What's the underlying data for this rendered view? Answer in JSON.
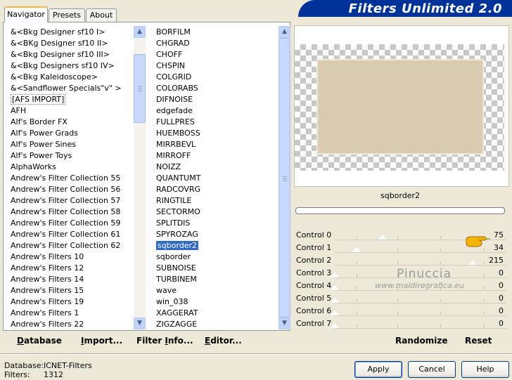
{
  "tabs": [
    "Navigator",
    "Presets",
    "About"
  ],
  "app_title": "Filters Unlimited 2.0",
  "categories": [
    "&<Bkg Designer sf10 I>",
    "&<BKg Designer sf10 II>",
    "&<Bkg Designer sf10 III>",
    "&<Bkg Designers sf10 IV>",
    "&<Bkg Kaleidoscope>",
    "&<Sandflower Specials\"v\" >",
    "[AFS IMPORT]",
    "AFH",
    "Alf's Border FX",
    "Alf's Power Grads",
    "Alf's Power Sines",
    "Alf's Power Toys",
    "AlphaWorks",
    "Andrew's Filter Collection 55",
    "Andrew's Filter Collection 56",
    "Andrew's Filter Collection 57",
    "Andrew's Filter Collection 58",
    "Andrew's Filter Collection 59",
    "Andrew's Filter Collection 61",
    "Andrew's Filter Collection 62",
    "Andrew's Filters 10",
    "Andrew's Filters 12",
    "Andrew's Filters 14",
    "Andrew's Filters 15",
    "Andrew's Filters 19",
    "Andrew's Filters 1",
    "Andrew's Filters 22"
  ],
  "filters": [
    "BORFILM",
    "CHGRAD",
    "CHOFF",
    "CHSPIN",
    "COLGRID",
    "COLORABS",
    "DIFNOISE",
    "edgefade",
    "FULLPRES",
    "HUEMBOSS",
    "MIRRBEVL",
    "MIRROFF",
    "NOIZZ",
    "QUANTUMT",
    "RADCOVRG",
    "RINGTILE",
    "SECTORMO",
    "SPLITDIS",
    "SPYROZAG",
    "sqborder2",
    "sqborder",
    "SUBNOISE",
    "TURBINEM",
    "wave",
    "win_038",
    "XAGGERAT",
    "ZIGZAGGE"
  ],
  "filter_name": "sqborder2",
  "controls": [
    {
      "label": "Control 0",
      "value": "75"
    },
    {
      "label": "Control 1",
      "value": "34"
    },
    {
      "label": "Control 2",
      "value": "215"
    },
    {
      "label": "Control 3",
      "value": "0"
    },
    {
      "label": "Control 4",
      "value": "0"
    },
    {
      "label": "Control 5",
      "value": "0"
    },
    {
      "label": "Control 6",
      "value": "0"
    },
    {
      "label": "Control 7",
      "value": "0"
    }
  ],
  "watermark": {
    "name": "Pinuccia",
    "url": "www.maidiregrafica.eu"
  },
  "left_buttons": {
    "database": {
      "u": "D",
      "rest": "atabase"
    },
    "import": {
      "u": "I",
      "rest": "mport..."
    },
    "filter_info": {
      "pre": "Filter ",
      "u": "I",
      "rest": "nfo..."
    },
    "editor": {
      "u": "E",
      "rest": "ditor..."
    }
  },
  "randomize": "Randomize",
  "reset": "Reset",
  "status": {
    "database_label": "Database:",
    "database_value": "ICNET-Filters",
    "filters_label": "Filters:",
    "filters_value": "1312"
  },
  "buttons": {
    "apply": "Apply",
    "cancel": "Cancel",
    "help": "Help"
  },
  "colors": {
    "banner": "#003399",
    "selection": "#316ac5",
    "preview_fill": "#d9ccb0"
  }
}
